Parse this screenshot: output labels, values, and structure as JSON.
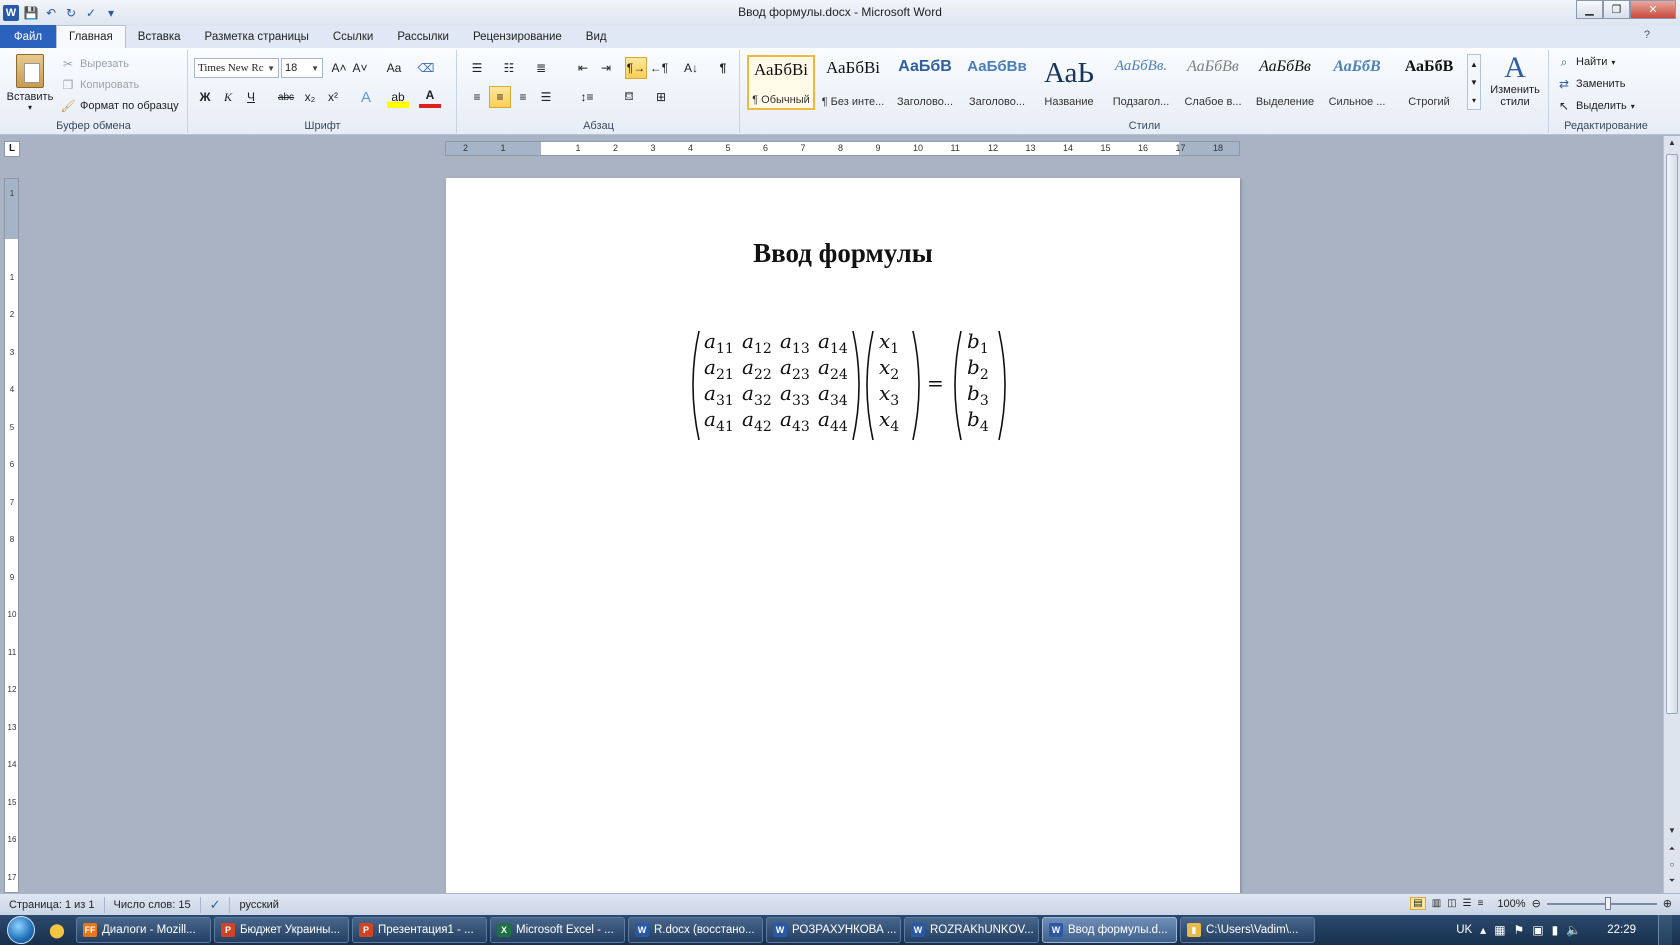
{
  "window": {
    "title": "Ввод формулы.docx  -  Microsoft Word",
    "controls": {
      "minimize": "▁",
      "maximize": "❐",
      "close": "✕"
    }
  },
  "qat": {
    "word_logo": "W",
    "save": "💾",
    "undo": "↶",
    "redo": "↻",
    "spell": "✓",
    "more": "▾"
  },
  "tabs": [
    {
      "label": "Файл"
    },
    {
      "label": "Главная"
    },
    {
      "label": "Вставка"
    },
    {
      "label": "Разметка страницы"
    },
    {
      "label": "Ссылки"
    },
    {
      "label": "Рассылки"
    },
    {
      "label": "Рецензирование"
    },
    {
      "label": "Вид"
    }
  ],
  "ribbon": {
    "clipboard": {
      "group_label": "Буфер обмена",
      "paste": "Вставить",
      "cut": "Вырезать",
      "copy": "Копировать",
      "format_painter": "Формат по образцу"
    },
    "font": {
      "group_label": "Шрифт",
      "font_name": "Times New Rc",
      "font_size": "18",
      "grow": "A˄",
      "shrink": "A˅",
      "change_case": "Aa",
      "clear": "⌫",
      "bold": "Ж",
      "italic": "К",
      "underline": "Ч",
      "strike": "abc",
      "subscript": "x₂",
      "superscript": "x²",
      "effects": "A",
      "highlight": "ab",
      "color": "A"
    },
    "paragraph": {
      "group_label": "Абзац",
      "pilcrow": "¶",
      "sort": "A↓"
    },
    "styles": {
      "group_label": "Стили",
      "items": [
        {
          "sample": "АаБбВі",
          "name": "¶ Обычный"
        },
        {
          "sample": "АаБбВі",
          "name": "¶ Без инте..."
        },
        {
          "sample": "АаБбВ",
          "name": "Заголово..."
        },
        {
          "sample": "АаБбВв",
          "name": "Заголово..."
        },
        {
          "sample": "АаЬ",
          "name": "Название"
        },
        {
          "sample": "АаБбВв.",
          "name": "Подзагол..."
        },
        {
          "sample": "АаБбВв",
          "name": "Слабое в..."
        },
        {
          "sample": "АаБбВв",
          "name": "Выделение"
        },
        {
          "sample": "АаБбВ",
          "name": "Сильное ..."
        },
        {
          "sample": "АаБбВ",
          "name": "Строгий"
        }
      ],
      "change_styles": "Изменить стили"
    },
    "editing": {
      "group_label": "Редактирование",
      "find": "Найти",
      "replace": "Заменить",
      "select": "Выделить"
    }
  },
  "ruler": {
    "corner": "L",
    "h_ticks": [
      "2",
      "1",
      "1",
      "2",
      "3",
      "4",
      "5",
      "6",
      "7",
      "8",
      "9",
      "10",
      "11",
      "12",
      "13",
      "14",
      "15",
      "16",
      "17",
      "18"
    ],
    "v_ticks": [
      "1",
      "1",
      "2",
      "3",
      "4",
      "5",
      "6",
      "7",
      "8",
      "9",
      "10",
      "11",
      "12",
      "13",
      "14",
      "15",
      "16",
      "17"
    ]
  },
  "document": {
    "title": "Ввод формулы",
    "formula": {
      "matrix_a": [
        [
          "a11",
          "a12",
          "a13",
          "a14"
        ],
        [
          "a21",
          "a22",
          "a23",
          "a24"
        ],
        [
          "a31",
          "a32",
          "a33",
          "a34"
        ],
        [
          "a41",
          "a42",
          "a43",
          "a44"
        ]
      ],
      "vector_x": [
        "x1",
        "x2",
        "x3",
        "x4"
      ],
      "vector_b": [
        "b1",
        "b2",
        "b3",
        "b4"
      ],
      "equals": "="
    }
  },
  "status": {
    "page": "Страница: 1 из 1",
    "words": "Число слов: 15",
    "language": "русский",
    "zoom": "100%"
  },
  "taskbar": {
    "items": [
      {
        "label": "Диалоги - Mozill...",
        "icon": "FF",
        "color": "#e8751a"
      },
      {
        "label": "Бюджет Украины...",
        "icon": "P",
        "color": "#d04423"
      },
      {
        "label": "Презентация1 - ...",
        "icon": "P",
        "color": "#d04423"
      },
      {
        "label": "Microsoft Excel - ...",
        "icon": "X",
        "color": "#1e7145"
      },
      {
        "label": "R.docx (восстано...",
        "icon": "W",
        "color": "#2a58a8"
      },
      {
        "label": "РОЗРАХУНКОВА ...",
        "icon": "W",
        "color": "#2a58a8"
      },
      {
        "label": "ROZRAKhUNKOV...",
        "icon": "W",
        "color": "#2a58a8"
      },
      {
        "label": "Ввод формулы.d...",
        "icon": "W",
        "color": "#2a58a8",
        "active": true
      },
      {
        "label": "C:\\Users\\Vadim\\...",
        "icon": "▮",
        "color": "#e9b949"
      }
    ],
    "tray": {
      "lang": "UK",
      "time": "22:29"
    }
  }
}
